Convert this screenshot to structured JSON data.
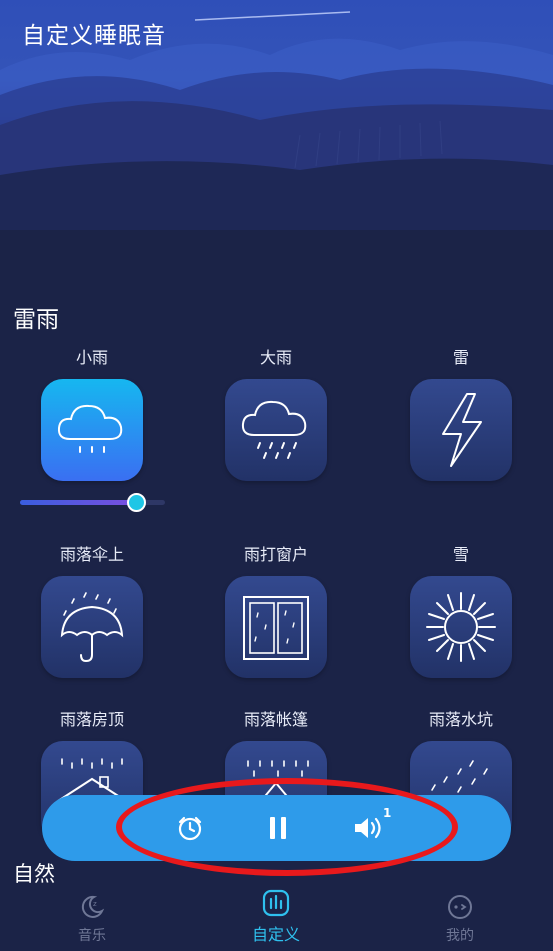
{
  "app": {
    "title": "自定义睡眠音"
  },
  "sections": [
    {
      "title": "雷雨"
    },
    {
      "title": "自然"
    }
  ],
  "sounds": [
    {
      "label": "小雨",
      "icon": "cloud-light-rain-icon",
      "active": true,
      "volume": 0.8
    },
    {
      "label": "大雨",
      "icon": "cloud-heavy-rain-icon",
      "active": false
    },
    {
      "label": "雷",
      "icon": "lightning-icon",
      "active": false
    },
    {
      "label": "雨落伞上",
      "icon": "umbrella-rain-icon",
      "active": false
    },
    {
      "label": "雨打窗户",
      "icon": "window-rain-icon",
      "active": false
    },
    {
      "label": "雪",
      "icon": "snowflake-icon",
      "active": false
    },
    {
      "label": "雨落房顶",
      "icon": "roof-rain-icon",
      "active": false
    },
    {
      "label": "雨落帐篷",
      "icon": "tent-rain-icon",
      "active": false
    },
    {
      "label": "雨落水坑",
      "icon": "puddle-rain-icon",
      "active": false
    }
  ],
  "player": {
    "timer_icon": "timer-icon",
    "pause_icon": "pause-icon",
    "volume_icon": "volume-icon",
    "active_sound_count": "1"
  },
  "tabs": [
    {
      "label": "音乐",
      "icon": "moon-icon",
      "active": false
    },
    {
      "label": "自定义",
      "icon": "equalizer-icon",
      "active": true
    },
    {
      "label": "我的",
      "icon": "face-icon",
      "active": false
    }
  ],
  "colors": {
    "background": "#1b2347",
    "tile_active_start": "#16b7f0",
    "tile_active_end": "#3a6ff2",
    "player_bar": "#2e9bea",
    "tab_active": "#2fc0ee",
    "highlight_ring": "#e8191c"
  }
}
